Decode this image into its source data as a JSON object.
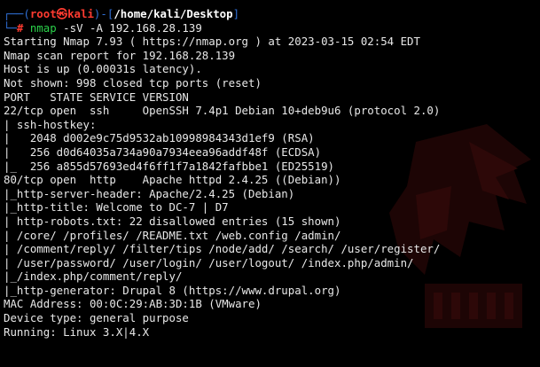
{
  "prompt": {
    "corner_top": "┌──(",
    "user": "root㉿kali",
    "dir_open": ")-[",
    "path": "/home/kali/Desktop",
    "dir_close": "]",
    "corner_bottom": "└─",
    "hash": "# ",
    "command": "nmap",
    "args": " -sV -A 192.168.28.139"
  },
  "output": [
    "Starting Nmap 7.93 ( https://nmap.org ) at 2023-03-15 02:54 EDT",
    "Nmap scan report for 192.168.28.139",
    "Host is up (0.00031s latency).",
    "Not shown: 998 closed tcp ports (reset)",
    "PORT   STATE SERVICE VERSION",
    "22/tcp open  ssh     OpenSSH 7.4p1 Debian 10+deb9u6 (protocol 2.0)",
    "| ssh-hostkey: ",
    "|   2048 d002e9c75d9532ab10998984343d1ef9 (RSA)",
    "|   256 d0d64035a734a90a7934eea96addf48f (ECDSA)",
    "|_  256 a855d57693ed4f6ff1f7a1842fafbbe1 (ED25519)",
    "80/tcp open  http    Apache httpd 2.4.25 ((Debian))",
    "|_http-server-header: Apache/2.4.25 (Debian)",
    "|_http-title: Welcome to DC-7 | D7",
    "| http-robots.txt: 22 disallowed entries (15 shown)",
    "| /core/ /profiles/ /README.txt /web.config /admin/ ",
    "| /comment/reply/ /filter/tips /node/add/ /search/ /user/register/ ",
    "| /user/password/ /user/login/ /user/logout/ /index.php/admin/ ",
    "|_/index.php/comment/reply/",
    "|_http-generator: Drupal 8 (https://www.drupal.org)",
    "MAC Address: 00:0C:29:AB:3D:1B (VMware)",
    "Device type: general purpose",
    "Running: Linux 3.X|4.X"
  ],
  "colors": {
    "background": "#000000",
    "text": "#e8e8e8",
    "prompt_frame": "#2f6fd6",
    "prompt_user": "#ff3b30",
    "command": "#2bd14a"
  },
  "background_art": "dark-red kali dragon wallpaper"
}
